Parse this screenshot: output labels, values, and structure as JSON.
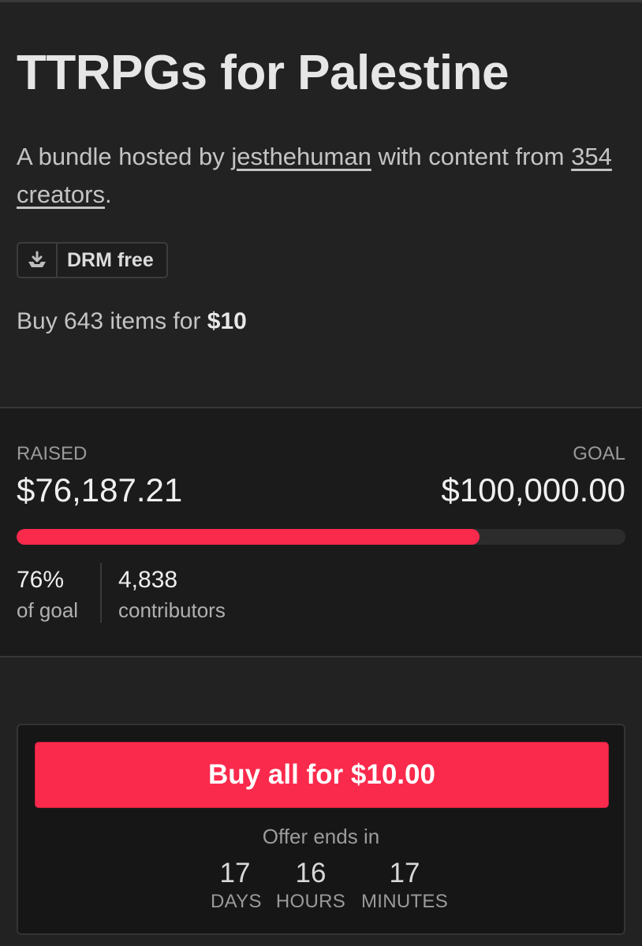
{
  "bundle": {
    "title": "TTRPGs for Palestine",
    "subtitle_prefix": "A bundle hosted by ",
    "host": "jesthehuman",
    "subtitle_middle": " with content from ",
    "creators": "354 creators",
    "subtitle_suffix": ".",
    "badge": {
      "icon": "download-tray-icon",
      "label": "DRM free"
    },
    "buy_line_prefix": "Buy 643 items for ",
    "buy_line_price": "$10"
  },
  "fundraising": {
    "raised_label": "RAISED",
    "raised_value": "$76,187.21",
    "goal_label": "GOAL",
    "goal_value": "$100,000.00",
    "progress_percent": 76,
    "percent_text": "76%",
    "percent_label": "of goal",
    "contributors_count": "4,838",
    "contributors_label": "contributors"
  },
  "purchase": {
    "button_label": "Buy all for $10.00",
    "offer_label": "Offer ends in",
    "countdown": [
      {
        "value": "17",
        "unit": "DAYS"
      },
      {
        "value": "16",
        "unit": "HOURS"
      },
      {
        "value": "17",
        "unit": "MINUTES"
      }
    ]
  },
  "colors": {
    "accent": "#fa2a4c",
    "background": "#222222",
    "panel": "#1b1b1b"
  }
}
